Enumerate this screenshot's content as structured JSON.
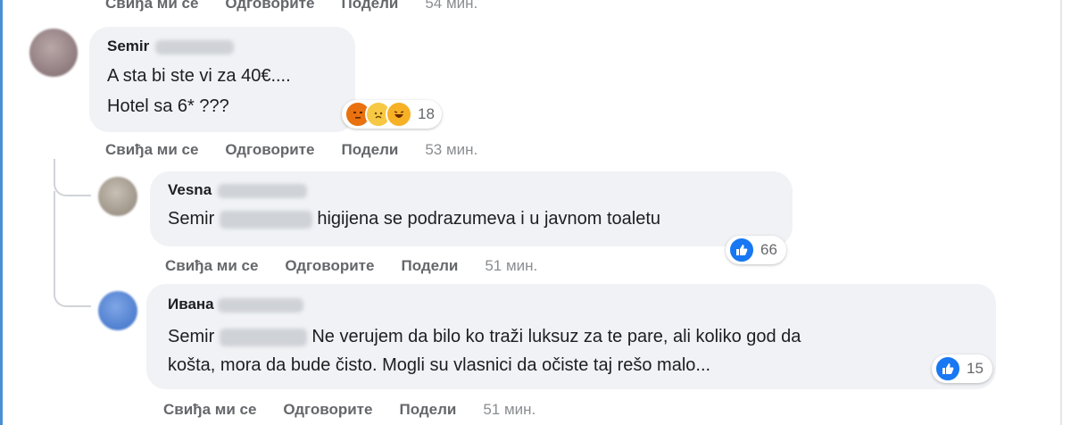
{
  "top_actions": {
    "like": "Свиђа ми се",
    "reply": "Одговорите",
    "share": "Подели",
    "time": "54 мин."
  },
  "comments": [
    {
      "author": "Semir",
      "lines": [
        "A sta bi ste vi za 40€....",
        "Hotel sa 6* ???"
      ],
      "reaction_count": "18",
      "reactions": [
        "angry",
        "sad",
        "haha"
      ],
      "actions": {
        "like": "Свиђа ми се",
        "reply": "Одговорите",
        "share": "Подели",
        "time": "53 мин."
      }
    },
    {
      "author": "Vesna",
      "mention": "Semir",
      "text": "higijena se podrazumeva i u javnom toaletu",
      "reaction_count": "66",
      "reactions": [
        "like"
      ],
      "actions": {
        "like": "Свиђа ми се",
        "reply": "Одговорите",
        "share": "Подели",
        "time": "51 мин."
      }
    },
    {
      "author": "Ивана",
      "mention": "Semir",
      "text_line1": "Ne verujem da bilo ko traži luksuz za te pare, ali koliko god da",
      "text_line2": "košta, mora da bude čisto. Mogli su vlasnici da očiste taj rešo malo...",
      "reaction_count": "15",
      "reactions": [
        "like"
      ],
      "actions": {
        "like": "Свиђа ми се",
        "reply": "Одговорите",
        "share": "Подели",
        "time": "51 мин."
      }
    }
  ],
  "colors": {
    "bubble": "#f0f2f5",
    "like_blue": "#1877f2",
    "muted": "#65676b"
  }
}
